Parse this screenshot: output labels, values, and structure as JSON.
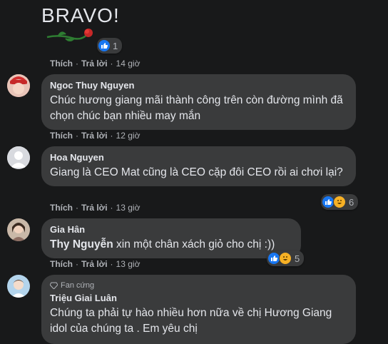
{
  "comments": [
    {
      "sticker": {
        "text": "BRAVO!"
      },
      "reaction_count": "1",
      "actions": {
        "like": "Thích",
        "reply": "Trả lời",
        "time": "14 giờ"
      }
    },
    {
      "author": "Ngoc Thuy Nguyen",
      "text": "Chúc hương giang mãi thành công trên còn đường mình đã chọn chúc bạn nhiều may mắn",
      "actions": {
        "like": "Thích",
        "reply": "Trả lời",
        "time": "12 giờ"
      }
    },
    {
      "author": "Hoa Nguyen",
      "text": "Giang là CEO Mat cũng là CEO cặp đôi CEO rồi ai chơi lại?",
      "reaction_count": "6",
      "actions": {
        "like": "Thích",
        "reply": "Trả lời",
        "time": "13 giờ"
      }
    },
    {
      "author": "Gia Hân",
      "mention": "Thy Nguyễn",
      "text": " xin một chân xách giỏ cho chị :))",
      "reaction_count": "5",
      "actions": {
        "like": "Thích",
        "reply": "Trả lời",
        "time": "13 giờ"
      }
    },
    {
      "badge": "Fan cứng",
      "author": "Triệu Giai Luân",
      "text": "Chúng ta phải tự hào nhiều hơn nữa về chị Hương Giang idol của chúng ta . Em yêu chị"
    }
  ],
  "colors": {
    "background": "#18191a",
    "bubble": "#3a3b3c",
    "like_blue": "#1877f2",
    "haha_yellow": "#f7b125"
  },
  "icons": [
    "like-icon",
    "haha-icon",
    "rose-icon",
    "diamond-icon"
  ]
}
